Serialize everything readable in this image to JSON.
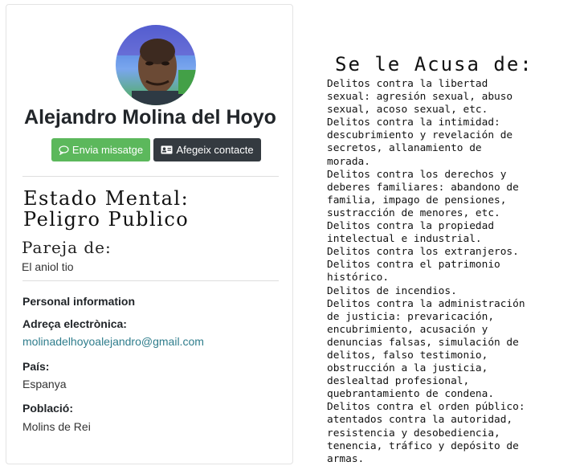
{
  "profile": {
    "name": "Alejandro Molina del Hoyo",
    "avatar_icon": "avatar-portrait",
    "message_button": "Envia missatge",
    "message_icon": "chat-bubble-icon",
    "contact_button": "Afegeix contacte",
    "contact_icon": "contact-card-icon"
  },
  "mental_state": {
    "line1": "Estado Mental:",
    "line2": "Peligro Publico"
  },
  "partner": {
    "label": "Pareja de:",
    "value": "El aniol tio"
  },
  "personal": {
    "title": "Personal information",
    "email_label": "Adreça electrònica:",
    "email_value": "molinadelhoyoalejandro@gmail.com",
    "country_label": "País:",
    "country_value": "Espanya",
    "town_label": "Població:",
    "town_value": "Molins de Rei"
  },
  "accusation": {
    "title": "Se le Acusa de:",
    "body": "Delitos contra la libertad\nsexual: agresión sexual, abuso\nsexual, acoso sexual, etc.\nDelitos contra la intimidad:\ndescubrimiento y revelación de\nsecretos, allanamiento de\nmorada.\nDelitos contra los derechos y\ndeberes familiares: abandono de\nfamilia, impago de pensiones,\nsustracción de menores, etc.\nDelitos contra la propiedad\nintelectual e industrial.\nDelitos contra los extranjeros.\nDelitos contra el patrimonio\nhistórico.\nDelitos de incendios.\nDelitos contra la administración\nde justicia: prevaricación,\nencubrimiento, acusación y\ndenuncias falsas, simulación de\ndelitos, falso testimonio,\nobstrucción a la justicia,\ndeslealtad profesional,\nquebrantamiento de condena.\nDelitos contra el orden público:\natentados contra la autoridad,\nresistencia y desobediencia,\ntenencia, tráfico y depósito de\narmas."
  },
  "colors": {
    "primary_green": "#5cb85c",
    "dark_button": "#343a40",
    "link": "#2f7d8c"
  }
}
